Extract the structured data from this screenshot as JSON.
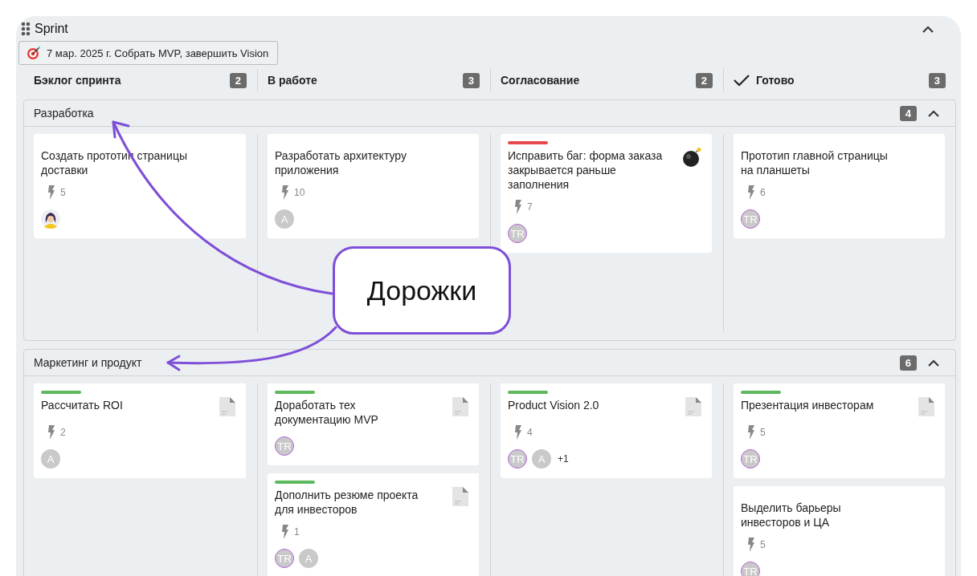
{
  "board": {
    "title": "Sprint",
    "expanded": true,
    "goal": "7 мар. 2025 г. Собрать MVP, завершить Vision"
  },
  "columns": [
    {
      "title": "Бэклог спринта",
      "count": "2",
      "done": false
    },
    {
      "title": "В работе",
      "count": "3",
      "done": false
    },
    {
      "title": "Согласование",
      "count": "2",
      "done": false
    },
    {
      "title": "Готово",
      "count": "3",
      "done": true
    }
  ],
  "lanes": [
    {
      "title": "Разработка",
      "count": "4",
      "expanded": true,
      "columns": [
        [
          {
            "title": "Создать прототип страницы доставки",
            "points": "5",
            "avatars": [
              {
                "kind": "photo"
              }
            ]
          }
        ],
        [
          {
            "title": "Разработать архитектуру приложения",
            "points": "10",
            "avatars": [
              {
                "kind": "initials",
                "text": "A",
                "ring": false
              }
            ]
          }
        ],
        [
          {
            "title": "Исправить баг: форма заказа закрывается раньше заполнения",
            "color": "#e5484d",
            "kind": "bug",
            "points": "7",
            "avatars": [
              {
                "kind": "initials",
                "text": "TR",
                "ring": true
              }
            ]
          }
        ],
        [
          {
            "title": "Прототип главной страницы на планшеты",
            "points": "6",
            "avatars": [
              {
                "kind": "initials",
                "text": "TR",
                "ring": true
              }
            ]
          }
        ]
      ]
    },
    {
      "title": "Маркетинг и продукт",
      "count": "6",
      "expanded": true,
      "columns": [
        [
          {
            "title": "Рассчитать ROI",
            "color": "#5cb85c",
            "kind": "doc",
            "points": "2",
            "avatars": [
              {
                "kind": "initials",
                "text": "A",
                "ring": false
              }
            ]
          }
        ],
        [
          {
            "title": "Доработать тех документацию MVP",
            "color": "#5cb85c",
            "kind": "doc",
            "avatars": [
              {
                "kind": "initials",
                "text": "TR",
                "ring": true
              }
            ]
          },
          {
            "title": "Дополнить резюме проекта для инвесторов",
            "color": "#5cb85c",
            "kind": "doc",
            "points": "1",
            "avatars": [
              {
                "kind": "initials",
                "text": "TR",
                "ring": true
              },
              {
                "kind": "initials",
                "text": "A",
                "ring": false
              }
            ]
          }
        ],
        [
          {
            "title": "Product Vision 2.0",
            "color": "#5cb85c",
            "kind": "doc",
            "points": "4",
            "avatars": [
              {
                "kind": "initials",
                "text": "TR",
                "ring": true
              },
              {
                "kind": "initials",
                "text": "A",
                "ring": false
              }
            ],
            "more": "+1"
          }
        ],
        [
          {
            "title": "Презентация инвесторам",
            "color": "#5cb85c",
            "kind": "doc",
            "points": "5",
            "avatars": [
              {
                "kind": "initials",
                "text": "TR",
                "ring": true
              }
            ]
          },
          {
            "title": "Выделить барьеры инвесторов и ЦА",
            "points": "5",
            "avatars": [
              {
                "kind": "initials",
                "text": "TR",
                "ring": true
              }
            ]
          }
        ]
      ]
    }
  ],
  "callout": {
    "text": "Дорожки"
  }
}
